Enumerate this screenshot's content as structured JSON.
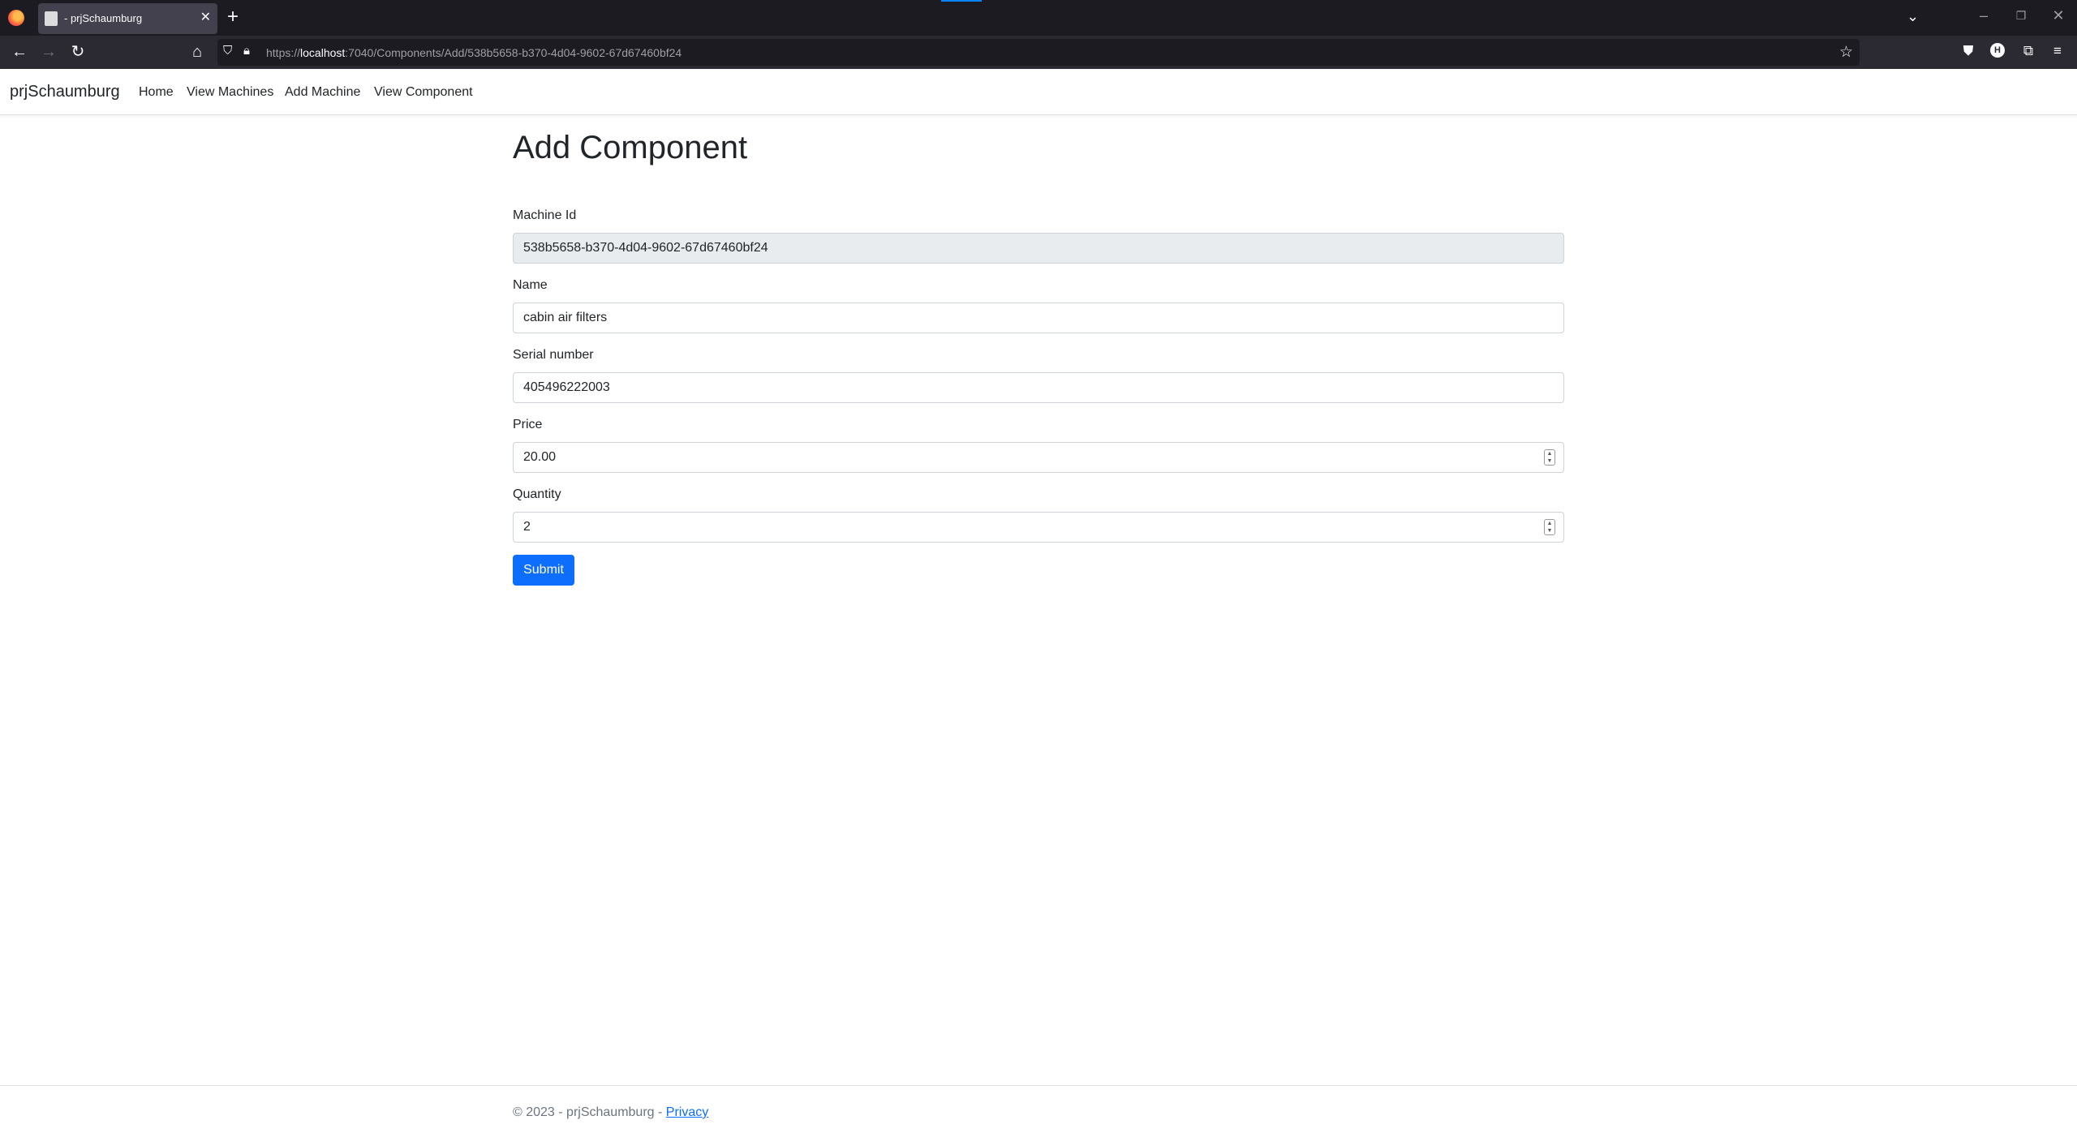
{
  "browser": {
    "tab_title": "- prjSchaumburg",
    "tab_close_glyph": "✕",
    "new_tab_glyph": "+",
    "url_scheme": "https://",
    "url_host": "localhost",
    "url_path": ":7040/Components/Add/538b5658-b370-4d04-9602-67d67460bf24",
    "profile_initial": "H"
  },
  "site": {
    "brand": "prjSchaumburg",
    "nav": [
      "Home",
      "View Machines",
      "Add Machine",
      "View Component"
    ]
  },
  "page": {
    "title": "Add Component"
  },
  "form": {
    "machine_id_label": "Machine Id",
    "machine_id_value": "538b5658-b370-4d04-9602-67d67460bf24",
    "name_label": "Name",
    "name_value": "cabin air filters",
    "serial_label": "Serial number",
    "serial_value": "405496222003",
    "price_label": "Price",
    "price_value": "20.00",
    "quantity_label": "Quantity",
    "quantity_value": "2",
    "submit_label": "Submit"
  },
  "footer": {
    "text": "© 2023 - prjSchaumburg - ",
    "privacy_link": "Privacy"
  },
  "colors": {
    "primary": "#0d6efd",
    "readonly_bg": "#e9ecef",
    "browser_dark": "#1c1b22",
    "browser_toolbar": "#2b2a33"
  }
}
